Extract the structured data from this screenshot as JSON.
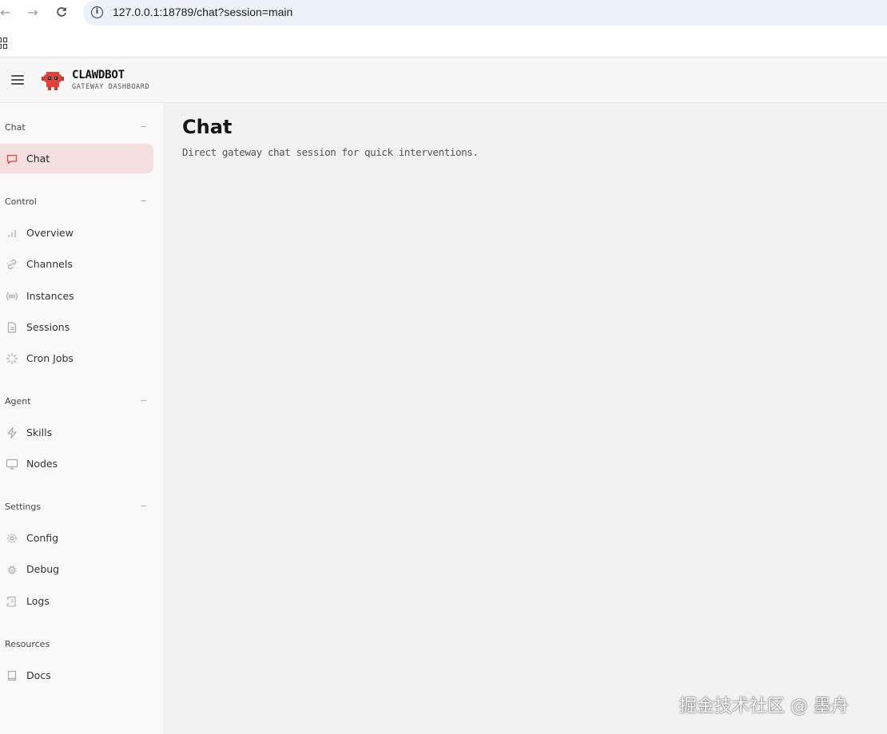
{
  "browser": {
    "url": "127.0.0.1:18789/chat?session=main"
  },
  "header": {
    "title": "CLAWDBOT",
    "subtitle": "GATEWAY DASHBOARD",
    "logo_icon": "robot-logo-icon",
    "accent_color": "#e0433a"
  },
  "sidebar": {
    "sections": [
      {
        "label": "Chat",
        "toggle": "−"
      },
      {
        "label": "Control",
        "toggle": "−"
      },
      {
        "label": "Agent",
        "toggle": "−"
      },
      {
        "label": "Settings",
        "toggle": "−"
      },
      {
        "label": "Resources"
      }
    ],
    "items": [
      {
        "label": "Chat",
        "icon": "chat-bubble-icon",
        "active": true
      },
      {
        "label": "Overview",
        "icon": "bar-chart-icon"
      },
      {
        "label": "Channels",
        "icon": "link-icon"
      },
      {
        "label": "Instances",
        "icon": "radio-icon"
      },
      {
        "label": "Sessions",
        "icon": "document-icon"
      },
      {
        "label": "Cron Jobs",
        "icon": "loader-icon"
      },
      {
        "label": "Skills",
        "icon": "zap-icon"
      },
      {
        "label": "Nodes",
        "icon": "monitor-icon"
      },
      {
        "label": "Config",
        "icon": "gear-icon"
      },
      {
        "label": "Debug",
        "icon": "bug-icon"
      },
      {
        "label": "Logs",
        "icon": "scroll-icon"
      },
      {
        "label": "Docs",
        "icon": "book-icon"
      }
    ]
  },
  "main": {
    "title": "Chat",
    "subtitle": "Direct gateway chat session for quick interventions."
  },
  "watermark": "掘金技术社区 @ 墨舟"
}
